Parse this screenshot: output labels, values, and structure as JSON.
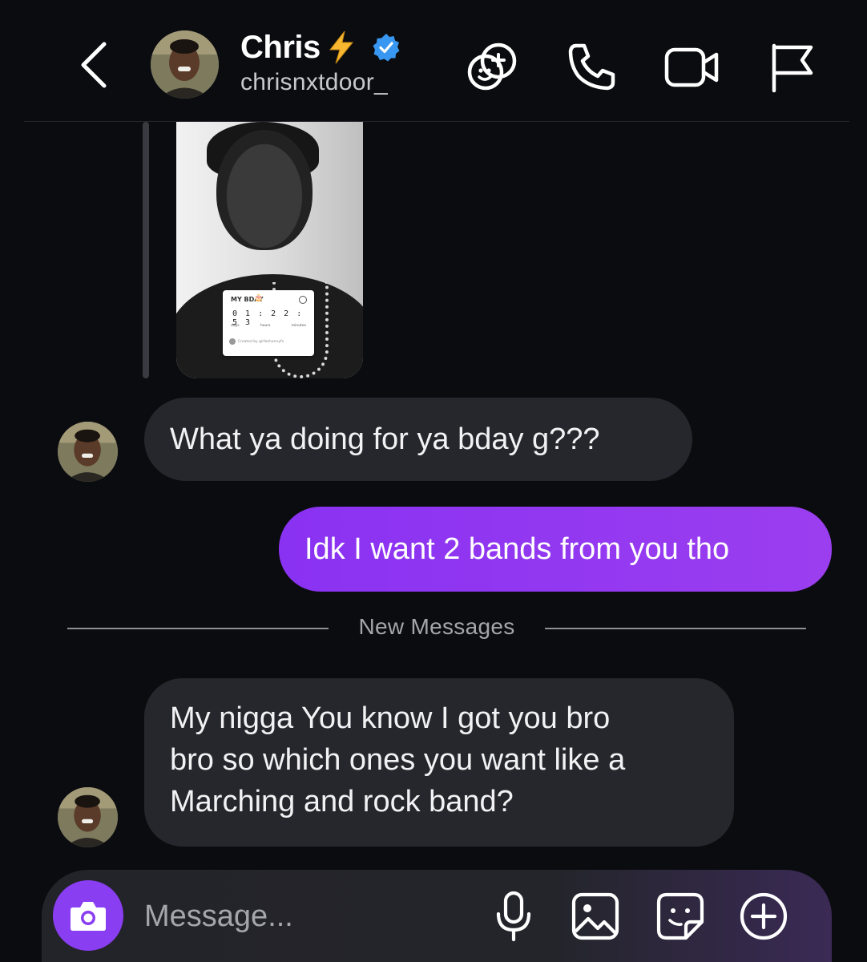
{
  "header": {
    "contact_name": "Chris",
    "username": "chrisnxtdoor_",
    "icons": [
      "back-icon",
      "games-icon",
      "phone-icon",
      "video-call-icon",
      "flag-icon"
    ]
  },
  "story_reply": {
    "countdown_title": "MY BDAY",
    "countdown_emoji": "🎂",
    "countdown_digits": "0 1 : 2 2 : 5 3",
    "countdown_units": [
      "days",
      "hours",
      "minutes"
    ],
    "countdown_footer": "Created by girlbehannyfx"
  },
  "messages": [
    {
      "direction": "incoming",
      "text": "What ya doing for ya bday g???"
    },
    {
      "direction": "outgoing",
      "text": "Idk I want 2 bands from you tho"
    },
    {
      "direction": "incoming",
      "lines": [
        "My nigga You know I got you bro",
        "bro so which ones you want like a",
        "Marching and rock band?"
      ]
    }
  ],
  "divider": {
    "label": "New Messages"
  },
  "composer": {
    "placeholder": "Message...",
    "icons": [
      "camera-icon",
      "microphone-icon",
      "gallery-icon",
      "sticker-icon",
      "plus-icon"
    ]
  },
  "colors": {
    "background": "#0b0c10",
    "incoming_bubble": "#26272c",
    "outgoing_bubble": "#8a32f2",
    "accent": "#8a3ef2",
    "verified": "#3897f0",
    "bolt": "#f7b731"
  }
}
